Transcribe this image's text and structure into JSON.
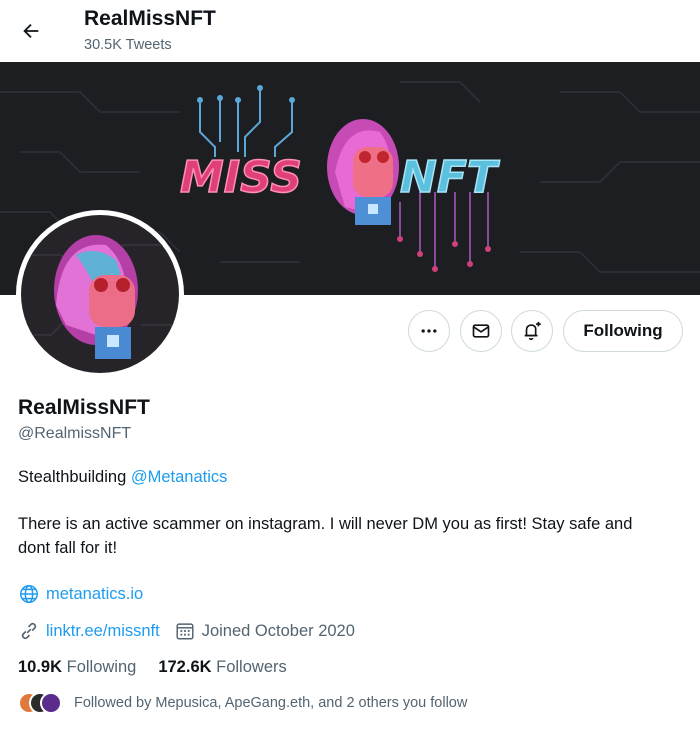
{
  "header": {
    "name": "RealMissNFT",
    "tweets_count": "30.5K Tweets"
  },
  "banner": {
    "logo_text_left": "MISS",
    "logo_text_right": "NFT"
  },
  "actions": {
    "more_icon": "more-horizontal-icon",
    "message_icon": "envelope-icon",
    "notify_icon": "bell-plus-icon",
    "follow_label": "Following"
  },
  "profile": {
    "name": "RealMissNFT",
    "handle": "@RealmissNFT",
    "bio_line1_text": "Stealthbuilding ",
    "bio_line1_mention": "@Metanatics",
    "bio_line2": "There is an active scammer on instagram. I will never DM you as first! Stay safe and",
    "bio_line3": "dont fall for it!",
    "website": "metanatics.io",
    "link": "linktr.ee/missnft",
    "joined": "Joined October 2020"
  },
  "stats": {
    "following_count": "10.9K",
    "following_label": "Following",
    "followers_count": "172.6K",
    "followers_label": "Followers"
  },
  "followed_by": {
    "text": "Followed by Mepusica, ApeGang.eth, and 2 others you follow"
  },
  "colors": {
    "accent": "#1d9bf0",
    "secondary_text": "#536471",
    "banner_bg": "#1d1e22",
    "logo_pink": "#e0407a",
    "logo_blue": "#5bc0de"
  }
}
